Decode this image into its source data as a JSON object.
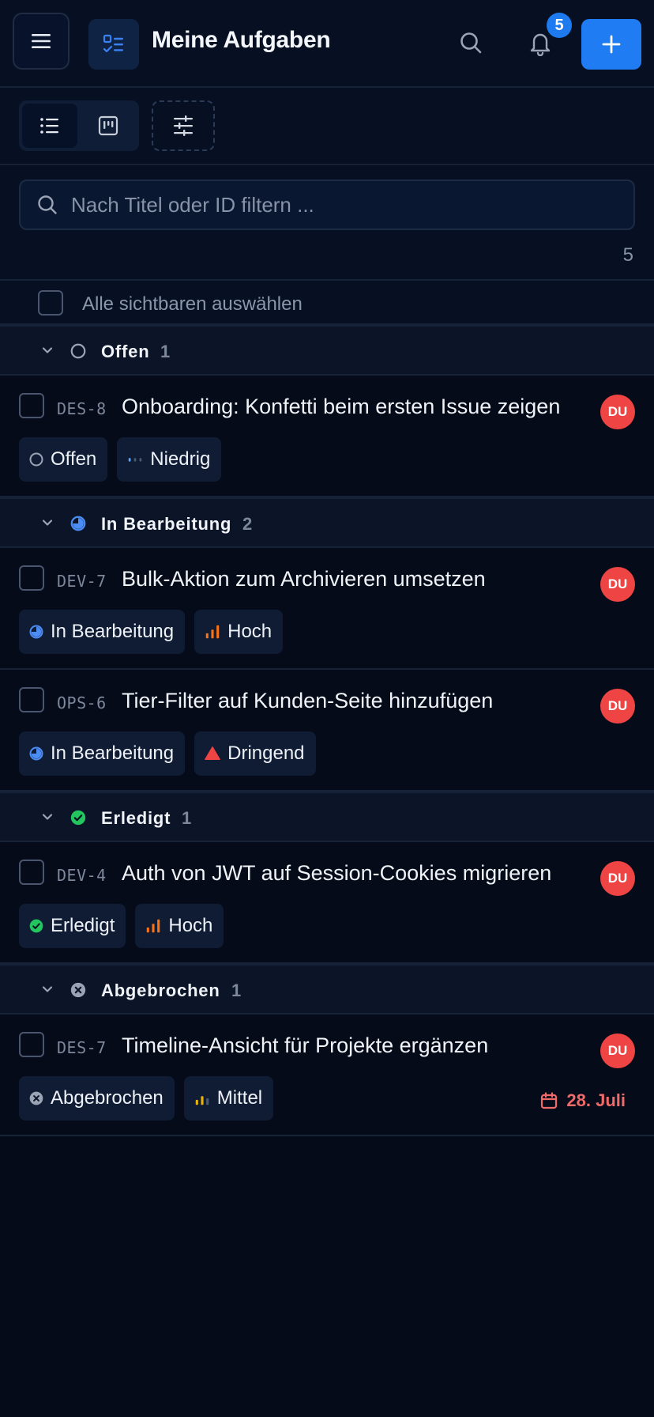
{
  "header": {
    "title": "Meine Aufgaben",
    "notification_count": "5"
  },
  "search": {
    "placeholder": "Nach Titel oder ID filtern ...",
    "value": "",
    "result_count": "5"
  },
  "select_all_label": "Alle sichtbaren auswählen",
  "colors": {
    "accent": "#1f7cf2",
    "avatar": "#ef4444",
    "status_open": "#9aa4b5",
    "status_progress": "#4c8cf5",
    "status_done": "#22c55e",
    "status_cancelled": "#9aa4b5",
    "priority_high": "#f97316",
    "priority_urgent": "#ef4444",
    "priority_medium": "#eab308",
    "priority_low": "#60a5fa",
    "due_overdue": "#f06a6a"
  },
  "groups": [
    {
      "label": "Offen",
      "count": "1",
      "icon": "circle-open-icon",
      "issues": [
        {
          "id": "DES-8",
          "title": "Onboarding: Konfetti beim ersten Issue zeigen",
          "avatar": "DU",
          "status": "Offen",
          "status_icon": "circle-open-icon",
          "priority": "Niedrig",
          "priority_icon": "priority-low-icon"
        }
      ]
    },
    {
      "label": "In Bearbeitung",
      "count": "2",
      "icon": "progress-icon",
      "issues": [
        {
          "id": "DEV-7",
          "title": "Bulk-Aktion zum Archivieren umsetzen",
          "avatar": "DU",
          "status": "In Bearbeitung",
          "status_icon": "progress-icon",
          "priority": "Hoch",
          "priority_icon": "priority-high-icon"
        },
        {
          "id": "OPS-6",
          "title": "Tier-Filter auf Kunden-Seite hinzufügen",
          "avatar": "DU",
          "status": "In Bearbeitung",
          "status_icon": "progress-icon",
          "priority": "Dringend",
          "priority_icon": "urgent-icon"
        }
      ]
    },
    {
      "label": "Erledigt",
      "count": "1",
      "icon": "check-circle-icon",
      "issues": [
        {
          "id": "DEV-4",
          "title": "Auth von JWT auf Session-Cookies migrieren",
          "avatar": "DU",
          "status": "Erledigt",
          "status_icon": "check-circle-icon",
          "priority": "Hoch",
          "priority_icon": "priority-high-icon"
        }
      ]
    },
    {
      "label": "Abgebrochen",
      "count": "1",
      "icon": "x-circle-icon",
      "issues": [
        {
          "id": "DES-7",
          "title": "Timeline-Ansicht für Projekte ergänzen",
          "avatar": "DU",
          "status": "Abgebrochen",
          "status_icon": "x-circle-icon",
          "priority": "Mittel",
          "priority_icon": "priority-medium-icon",
          "due": "28. Juli"
        }
      ]
    }
  ]
}
